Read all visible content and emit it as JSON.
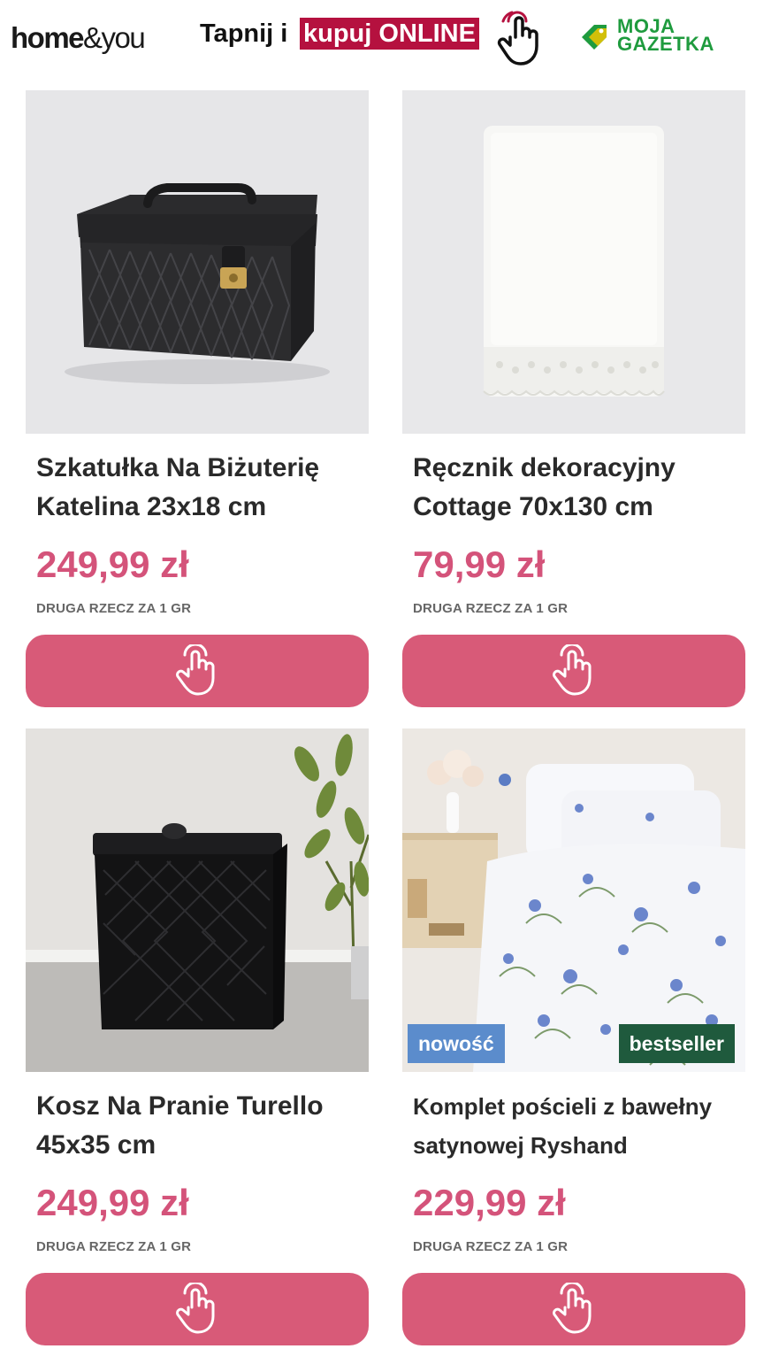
{
  "header": {
    "brand_bold": "home",
    "brand_rest": "&you",
    "tap_text": "Tapnij i",
    "tap_highlight": "kupuj ONLINE",
    "gazetka_line1": "MOJA",
    "gazetka_line2": "GAZETKA"
  },
  "products": [
    {
      "title": "Szkatułka Na Biżuterię Katelina 23x18 cm",
      "price": "249,99 zł",
      "promo": "DRUGA RZECZ ZA 1 GR"
    },
    {
      "title": "Ręcznik dekoracyjny Cottage 70x130 cm",
      "price": "79,99 zł",
      "promo": "DRUGA RZECZ ZA 1 GR"
    },
    {
      "title": "Kosz Na Pranie Turello 45x35 cm",
      "price": "249,99 zł",
      "promo": "DRUGA RZECZ ZA 1 GR"
    },
    {
      "title": "Komplet pościeli z bawełny satynowej Ryshand",
      "price": "229,99 zł",
      "promo": "DRUGA RZECZ ZA 1 GR",
      "badge_new": "nowość",
      "badge_best": "bestseller"
    }
  ],
  "colors": {
    "price": "#d4537a",
    "button": "#d85a78",
    "highlight": "#b5113f",
    "badge_new": "#5b8ccc",
    "badge_best": "#1f5a3d",
    "gazetka": "#1f9b3e"
  },
  "icons": {
    "tap": "hand-pointer-icon",
    "gazetka": "tag-icon"
  }
}
